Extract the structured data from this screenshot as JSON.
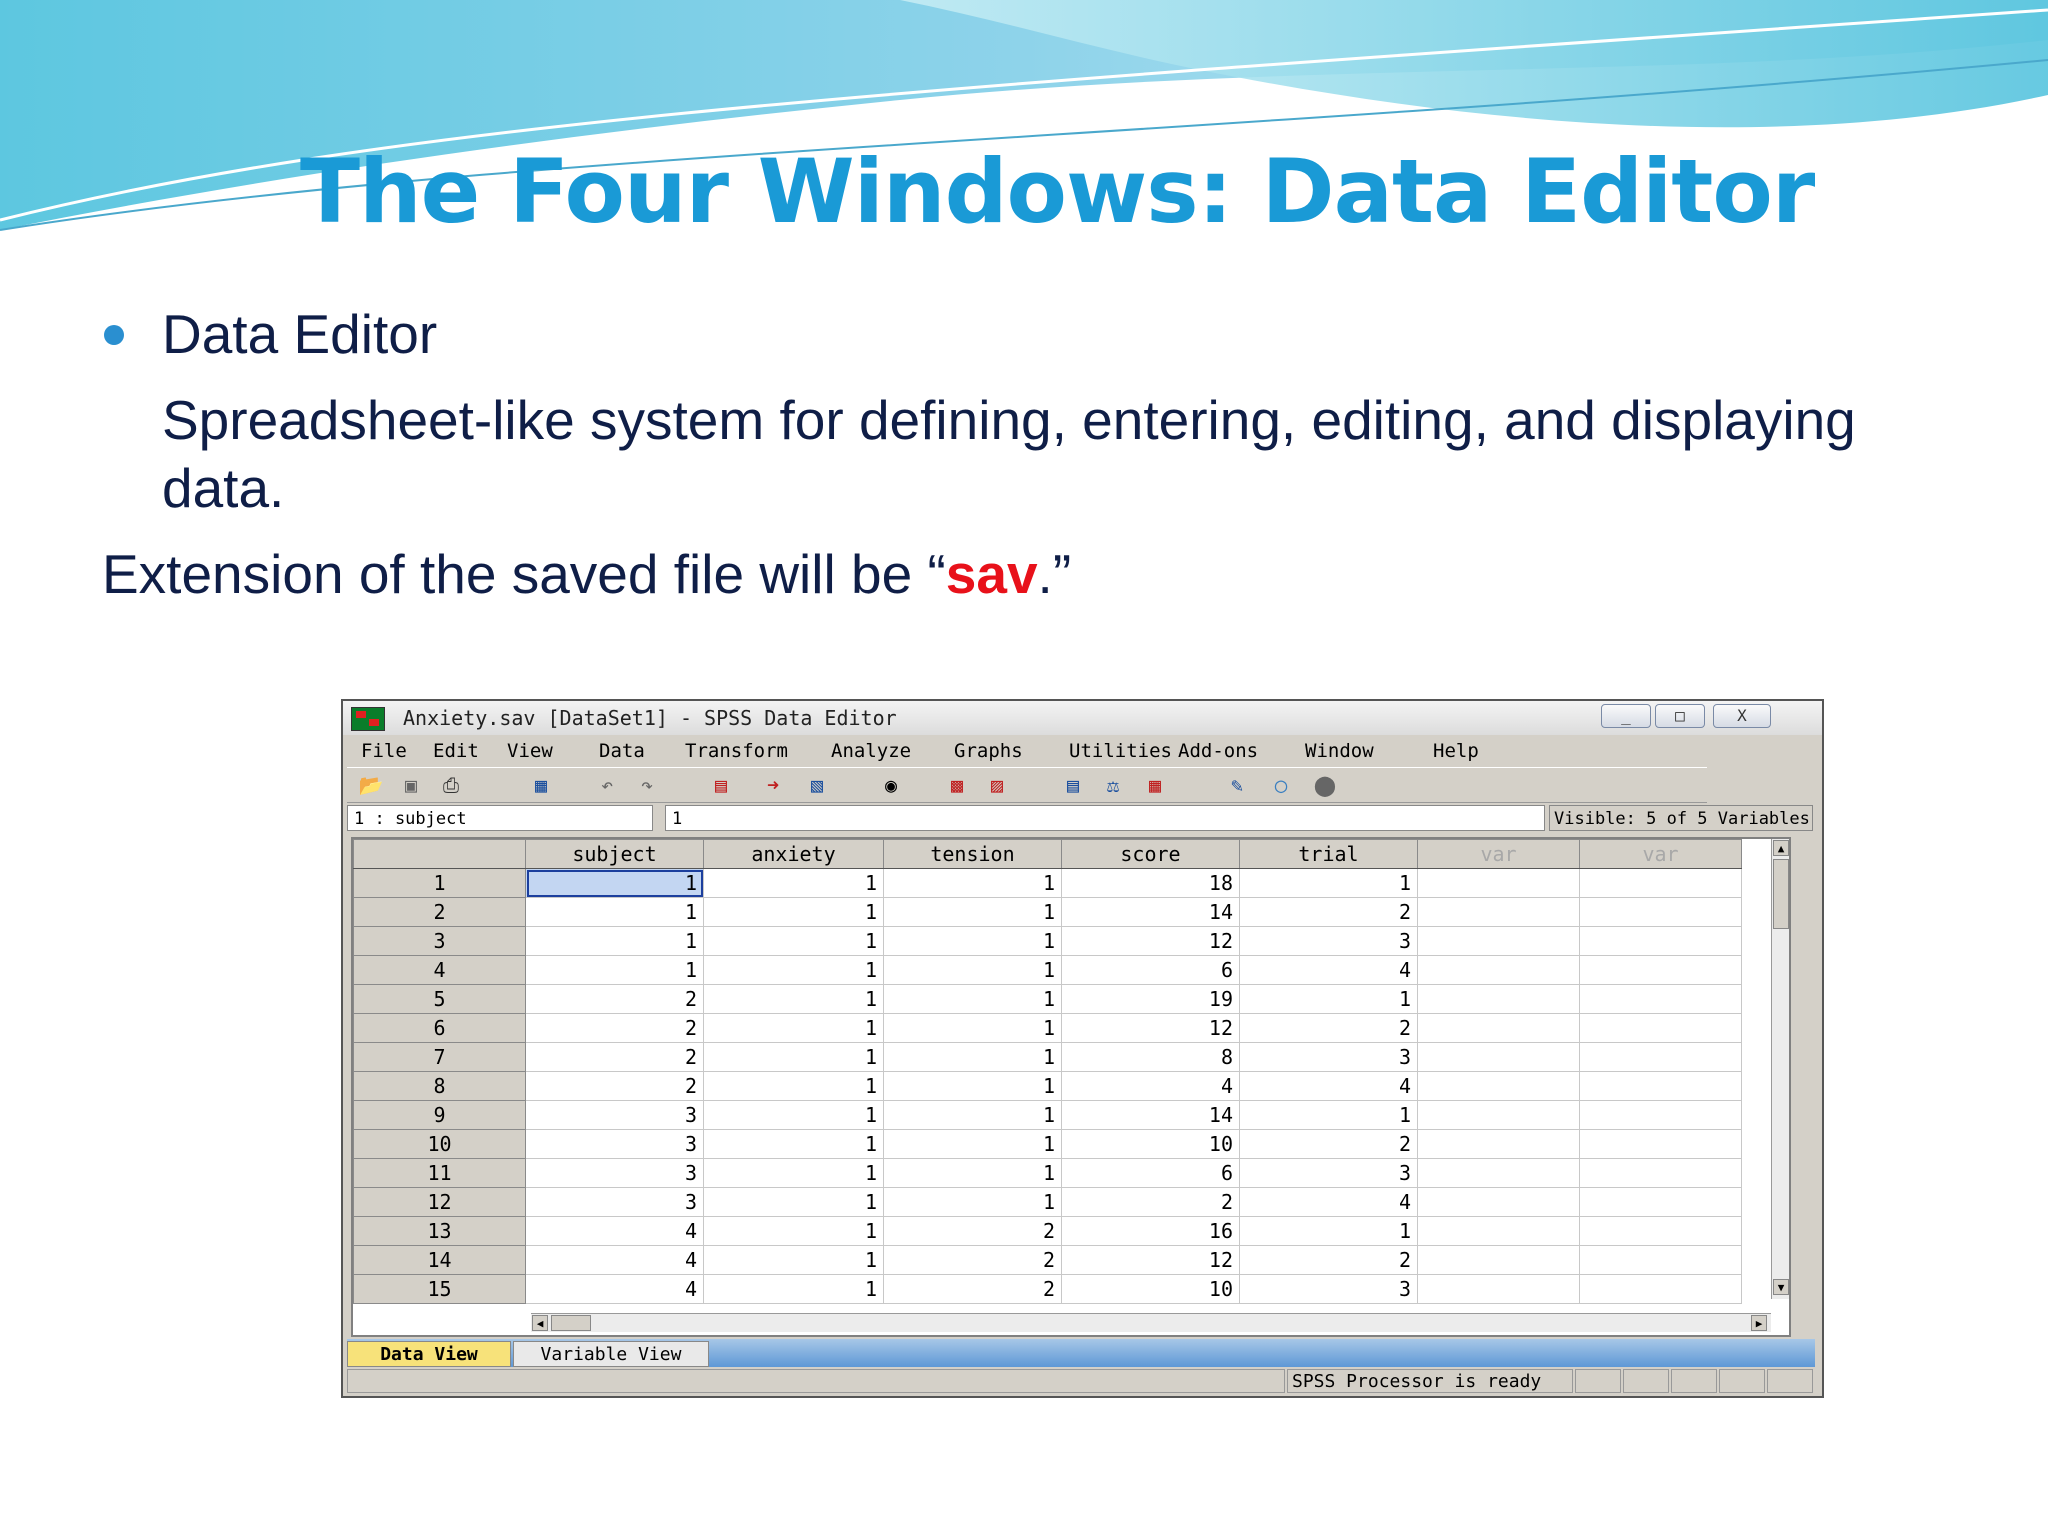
{
  "slide": {
    "title": "The Four Windows: Data Editor",
    "bullet": "Data Editor",
    "desc_line1": "Spreadsheet-like system for defining, entering, editing, and displaying",
    "desc_line2": "data.",
    "ext_prefix": "Extension of the saved file will be “",
    "ext_value": "sav",
    "ext_suffix": ".”",
    "colors": {
      "title": "#1a9ad6",
      "text": "#0f1e47",
      "highlight": "#e8111a"
    }
  },
  "window": {
    "title": "Anxiety.sav [DataSet1] - SPSS Data Editor",
    "buttons": {
      "minimize": "_",
      "maximize": "□",
      "close": "X"
    }
  },
  "menu": [
    "File",
    "Edit",
    "View",
    "Data",
    "Transform",
    "Analyze",
    "Graphs",
    "Utilities",
    "Add-ons",
    "Window",
    "Help"
  ],
  "toolbar": [
    "open-icon",
    "save-icon",
    "print-icon",
    "dialog-recall-icon",
    "undo-icon",
    "redo-icon",
    "goto-case-icon",
    "goto-variable-icon",
    "variables-icon",
    "find-icon",
    "insert-cases-icon",
    "insert-variable-icon",
    "split-file-icon",
    "weight-cases-icon",
    "select-cases-icon",
    "value-labels-icon",
    "use-sets-icon",
    "show-all-icon"
  ],
  "cellbar": {
    "ref": "1 : subject",
    "value": "1",
    "visible": "Visible: 5 of 5 Variables"
  },
  "grid": {
    "columns": [
      "subject",
      "anxiety",
      "tension",
      "score",
      "trial",
      "var",
      "var"
    ],
    "rows": [
      [
        "1",
        "1",
        "1",
        "1",
        "18",
        "1"
      ],
      [
        "2",
        "1",
        "1",
        "1",
        "14",
        "2"
      ],
      [
        "3",
        "1",
        "1",
        "1",
        "12",
        "3"
      ],
      [
        "4",
        "1",
        "1",
        "1",
        "6",
        "4"
      ],
      [
        "5",
        "2",
        "1",
        "1",
        "19",
        "1"
      ],
      [
        "6",
        "2",
        "1",
        "1",
        "12",
        "2"
      ],
      [
        "7",
        "2",
        "1",
        "1",
        "8",
        "3"
      ],
      [
        "8",
        "2",
        "1",
        "1",
        "4",
        "4"
      ],
      [
        "9",
        "3",
        "1",
        "1",
        "14",
        "1"
      ],
      [
        "10",
        "3",
        "1",
        "1",
        "10",
        "2"
      ],
      [
        "11",
        "3",
        "1",
        "1",
        "6",
        "3"
      ],
      [
        "12",
        "3",
        "1",
        "1",
        "2",
        "4"
      ],
      [
        "13",
        "4",
        "1",
        "2",
        "16",
        "1"
      ],
      [
        "14",
        "4",
        "1",
        "2",
        "12",
        "2"
      ],
      [
        "15",
        "4",
        "1",
        "2",
        "10",
        "3"
      ]
    ]
  },
  "tabs": {
    "data_view": "Data View",
    "variable_view": "Variable View"
  },
  "status": {
    "processor": "SPSS  Processor is ready"
  }
}
